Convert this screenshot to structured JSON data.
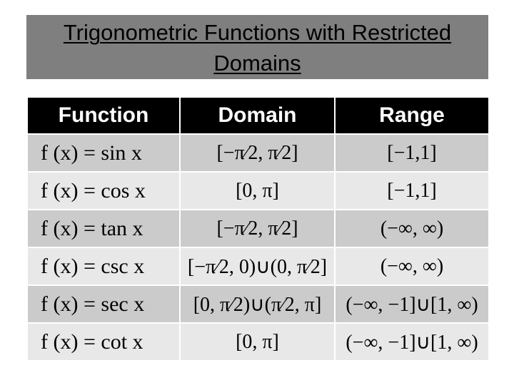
{
  "title": "Trigonometric Functions with Restricted Domains",
  "table": {
    "headers": [
      "Function",
      "Domain",
      "Range"
    ],
    "rows": [
      {
        "function": "f (x) = sin x",
        "domain": "[−π⁄2, π⁄2]",
        "range": "[−1,1]"
      },
      {
        "function": "f (x) = cos x",
        "domain": "[0, π]",
        "range": "[−1,1]"
      },
      {
        "function": "f (x) = tan x",
        "domain": "[−π⁄2, π⁄2]",
        "range": "(−∞, ∞)"
      },
      {
        "function": "f (x) = csc x",
        "domain": "[−π⁄2, 0)∪(0, π⁄2]",
        "range": "(−∞, ∞)"
      },
      {
        "function": "f (x) = sec x",
        "domain": "[0, π⁄2)∪(π⁄2, π]",
        "range": "(−∞, −1]∪[1, ∞)"
      },
      {
        "function": "f (x) = cot x",
        "domain": "[0, π]",
        "range": "(−∞, −1]∪[1, ∞)"
      }
    ]
  },
  "colors": {
    "title_bg": "#7f7f7f",
    "header_bg": "#000000",
    "row_dark": "#cbcbcb",
    "row_light": "#e8e8e8"
  }
}
